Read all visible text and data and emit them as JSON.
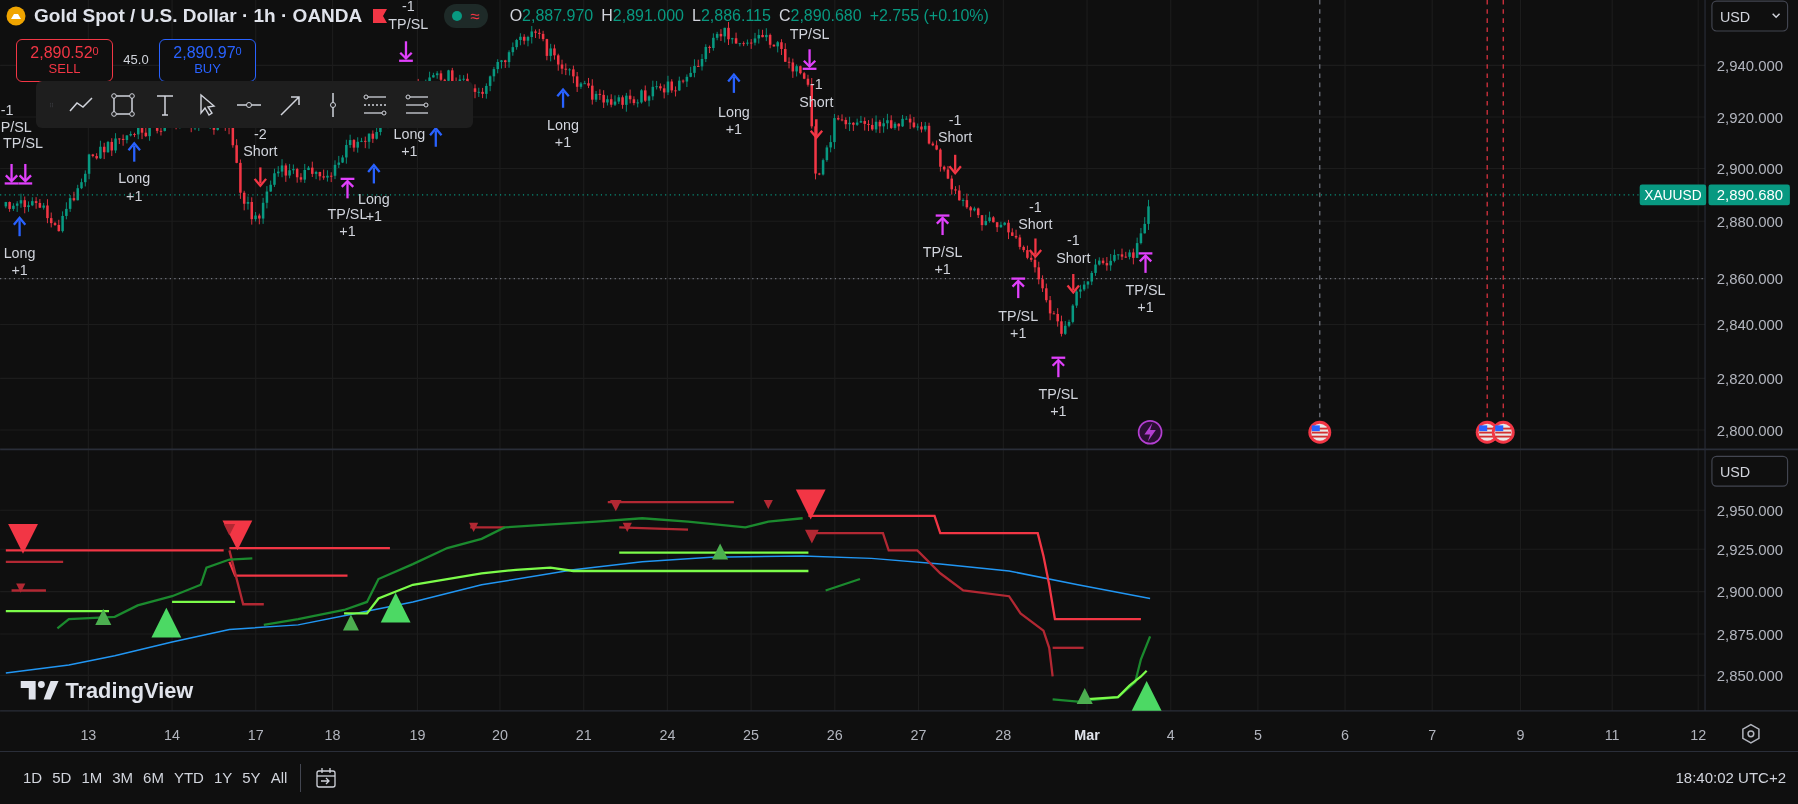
{
  "header": {
    "title": "Gold Spot / U.S. Dollar · 1h · OANDA",
    "status_glyph": "≈",
    "ohlc": [
      {
        "label": "O",
        "value": "2,887.970"
      },
      {
        "label": "H",
        "value": "2,891.000"
      },
      {
        "label": "L",
        "value": "2,886.115"
      },
      {
        "label": "C",
        "value": "2,890.680"
      }
    ],
    "change": "+2.755 (+0.10%)"
  },
  "trade": {
    "sell_price": "2,890.52$^{0}$",
    "sell_label": "SELL",
    "spread": "45.0",
    "buy_price": "2,890.97$^{0}$",
    "buy_label": "BUY"
  },
  "signals": [
    {
      "kind": "exit_long",
      "lines": [
        "-1",
        "P/SL"
      ]
    },
    {
      "kind": "exit_long",
      "lines": [
        "TP/SL"
      ]
    },
    {
      "kind": "long",
      "lines": [
        "Long",
        "+1"
      ]
    },
    {
      "kind": "long",
      "lines": [
        "Long",
        "+1"
      ]
    },
    {
      "kind": "short",
      "lines": [
        "-2",
        "Short"
      ]
    },
    {
      "kind": "exit_short",
      "lines": [
        "TP/SL",
        "+1"
      ]
    },
    {
      "kind": "long",
      "lines": [
        "Long",
        "+1"
      ]
    },
    {
      "kind": "long",
      "lines": [
        "Long",
        "+1"
      ]
    },
    {
      "kind": "exit_long",
      "lines": [
        "-1",
        "TP/SL"
      ]
    },
    {
      "kind": "long",
      "lines": [
        "Long",
        "+1"
      ]
    },
    {
      "kind": "long",
      "lines": [
        "Long",
        "+1"
      ]
    },
    {
      "kind": "exit_long",
      "lines": [
        "TP/SL"
      ]
    },
    {
      "kind": "short",
      "lines": [
        "-1",
        "Short"
      ]
    },
    {
      "kind": "short",
      "lines": [
        "-1",
        "Short"
      ]
    },
    {
      "kind": "exit_short",
      "lines": [
        "TP/SL",
        "+1"
      ]
    },
    {
      "kind": "short",
      "lines": [
        "-1",
        "Short"
      ]
    },
    {
      "kind": "short",
      "lines": [
        "-1",
        "Short"
      ]
    },
    {
      "kind": "exit_short",
      "lines": [
        "TP/SL",
        "+1"
      ]
    },
    {
      "kind": "exit_short",
      "lines": [
        "TP/SL",
        "+1"
      ]
    },
    {
      "kind": "exit_short",
      "lines": [
        "TP/SL",
        "+1"
      ]
    }
  ],
  "price_axis": {
    "currency": "USD",
    "ticks": [
      "2,940.000",
      "2,920.000",
      "2,900.000",
      "2,880.000",
      "2,860.000",
      "2,840.000",
      "2,820.000",
      "2,800.000"
    ],
    "symbol_tag": "XAUUSD",
    "last_price": "2,890.680"
  },
  "indicator_axis": {
    "currency": "USD",
    "ticks": [
      "2,950.000",
      "2,925.000",
      "2,900.000",
      "2,875.000",
      "2,850.000"
    ]
  },
  "time_axis": {
    "labels": [
      {
        "text": "13",
        "bold": false
      },
      {
        "text": "14",
        "bold": false
      },
      {
        "text": "17",
        "bold": false
      },
      {
        "text": "18",
        "bold": false
      },
      {
        "text": "19",
        "bold": false
      },
      {
        "text": "20",
        "bold": false
      },
      {
        "text": "21",
        "bold": false
      },
      {
        "text": "24",
        "bold": false
      },
      {
        "text": "25",
        "bold": false
      },
      {
        "text": "26",
        "bold": false
      },
      {
        "text": "27",
        "bold": false
      },
      {
        "text": "28",
        "bold": false
      },
      {
        "text": "Mar",
        "bold": true
      },
      {
        "text": "4",
        "bold": false
      },
      {
        "text": "5",
        "bold": false
      },
      {
        "text": "6",
        "bold": false
      },
      {
        "text": "7",
        "bold": false
      },
      {
        "text": "9",
        "bold": false
      },
      {
        "text": "11",
        "bold": false
      },
      {
        "text": "12",
        "bold": false
      }
    ]
  },
  "logo": "TradingView",
  "range_buttons": [
    "1D",
    "5D",
    "1M",
    "3M",
    "6M",
    "YTD",
    "1Y",
    "5Y",
    "All"
  ],
  "clock": "18:40:02 UTC+2"
}
